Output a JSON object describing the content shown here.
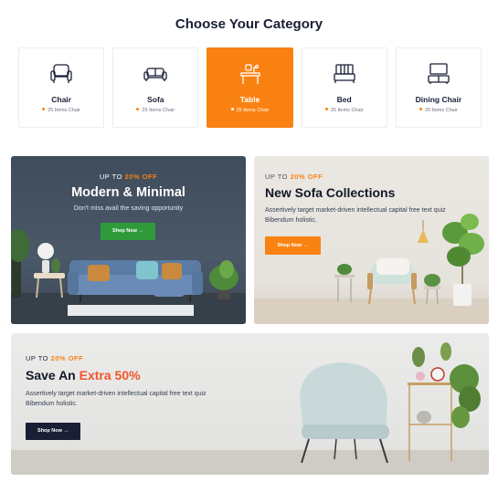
{
  "section_title": "Choose Your Category",
  "categories": [
    {
      "name": "Chair",
      "count": "25 Items Chair",
      "icon": "armchair-icon",
      "active": false
    },
    {
      "name": "Sofa",
      "count": "25 Items Chair",
      "icon": "sofa-icon",
      "active": false
    },
    {
      "name": "Table",
      "count": "25 Items Chair",
      "icon": "table-icon",
      "active": true
    },
    {
      "name": "Bed",
      "count": "25 Items Chair",
      "icon": "bed-icon",
      "active": false
    },
    {
      "name": "Dining Chair",
      "count": "25 Items Chair",
      "icon": "tv-stand-icon",
      "active": false
    }
  ],
  "banners": {
    "modern": {
      "tag_prefix": "UP TO",
      "tag_highlight": "20% OFF",
      "title": "Modern & Minimal",
      "subtitle": "Don't miss avail the saving opportunity",
      "button": "Shop Now →"
    },
    "sofa": {
      "tag_prefix": "UP TO",
      "tag_highlight": "20% OFF",
      "title": "New Sofa Collections",
      "subtitle": "Assertively target market-driven intellectual capital free text quiz Bibendum holistic.",
      "button": "Shop Now →"
    },
    "extra": {
      "tag_prefix": "UP TO",
      "tag_highlight": "20% OFF",
      "title_prefix": "Save An",
      "title_highlight": "Extra 50%",
      "subtitle": "Assertively target market-driven intellectual capital free text quiz Bibendum holistic.",
      "button": "Shop Now →"
    }
  },
  "colors": {
    "accent": "#f98212",
    "dark": "#1a1f36",
    "green_button": "#2e9a3a",
    "highlight_red": "#f0562b"
  }
}
